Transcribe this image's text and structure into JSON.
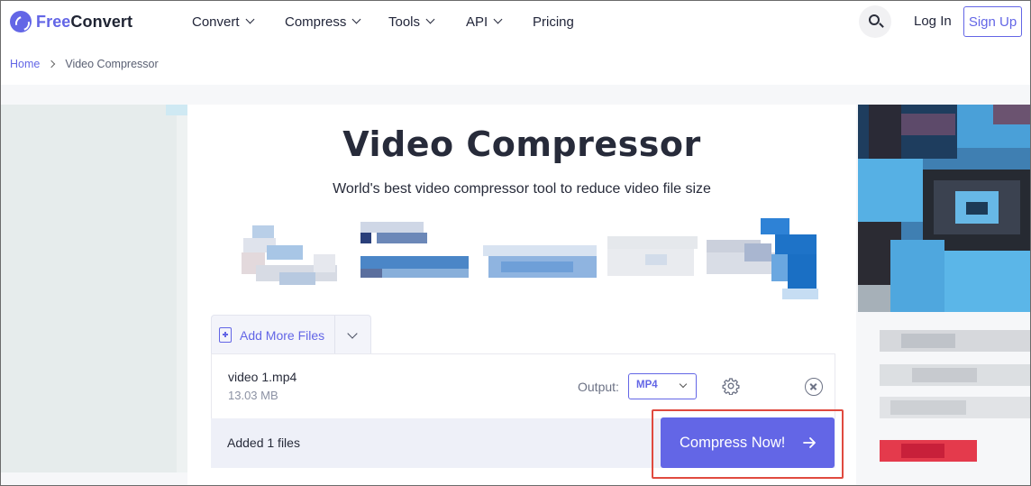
{
  "brand": {
    "name_part1": "Free",
    "name_part2": "Convert"
  },
  "nav": {
    "items": [
      {
        "label": "Convert",
        "has_dropdown": true
      },
      {
        "label": "Compress",
        "has_dropdown": true
      },
      {
        "label": "Tools",
        "has_dropdown": true
      },
      {
        "label": "API",
        "has_dropdown": true
      },
      {
        "label": "Pricing",
        "has_dropdown": false
      }
    ],
    "login": "Log In",
    "signup": "Sign Up",
    "search_icon": "search-icon"
  },
  "breadcrumb": {
    "home": "Home",
    "current": "Video Compressor"
  },
  "hero": {
    "title": "Video Compressor",
    "subtitle": "World's best video compressor tool to reduce video file size"
  },
  "uploader": {
    "add_more_label": "Add More Files",
    "file": {
      "name": "video 1.mp4",
      "size": "13.03 MB"
    },
    "output_label": "Output:",
    "output_value": "MP4",
    "added_text": "Added 1 files",
    "compress_label": "Compress Now!"
  },
  "colors": {
    "accent": "#6366e6",
    "highlight_border": "#e04a3f"
  }
}
